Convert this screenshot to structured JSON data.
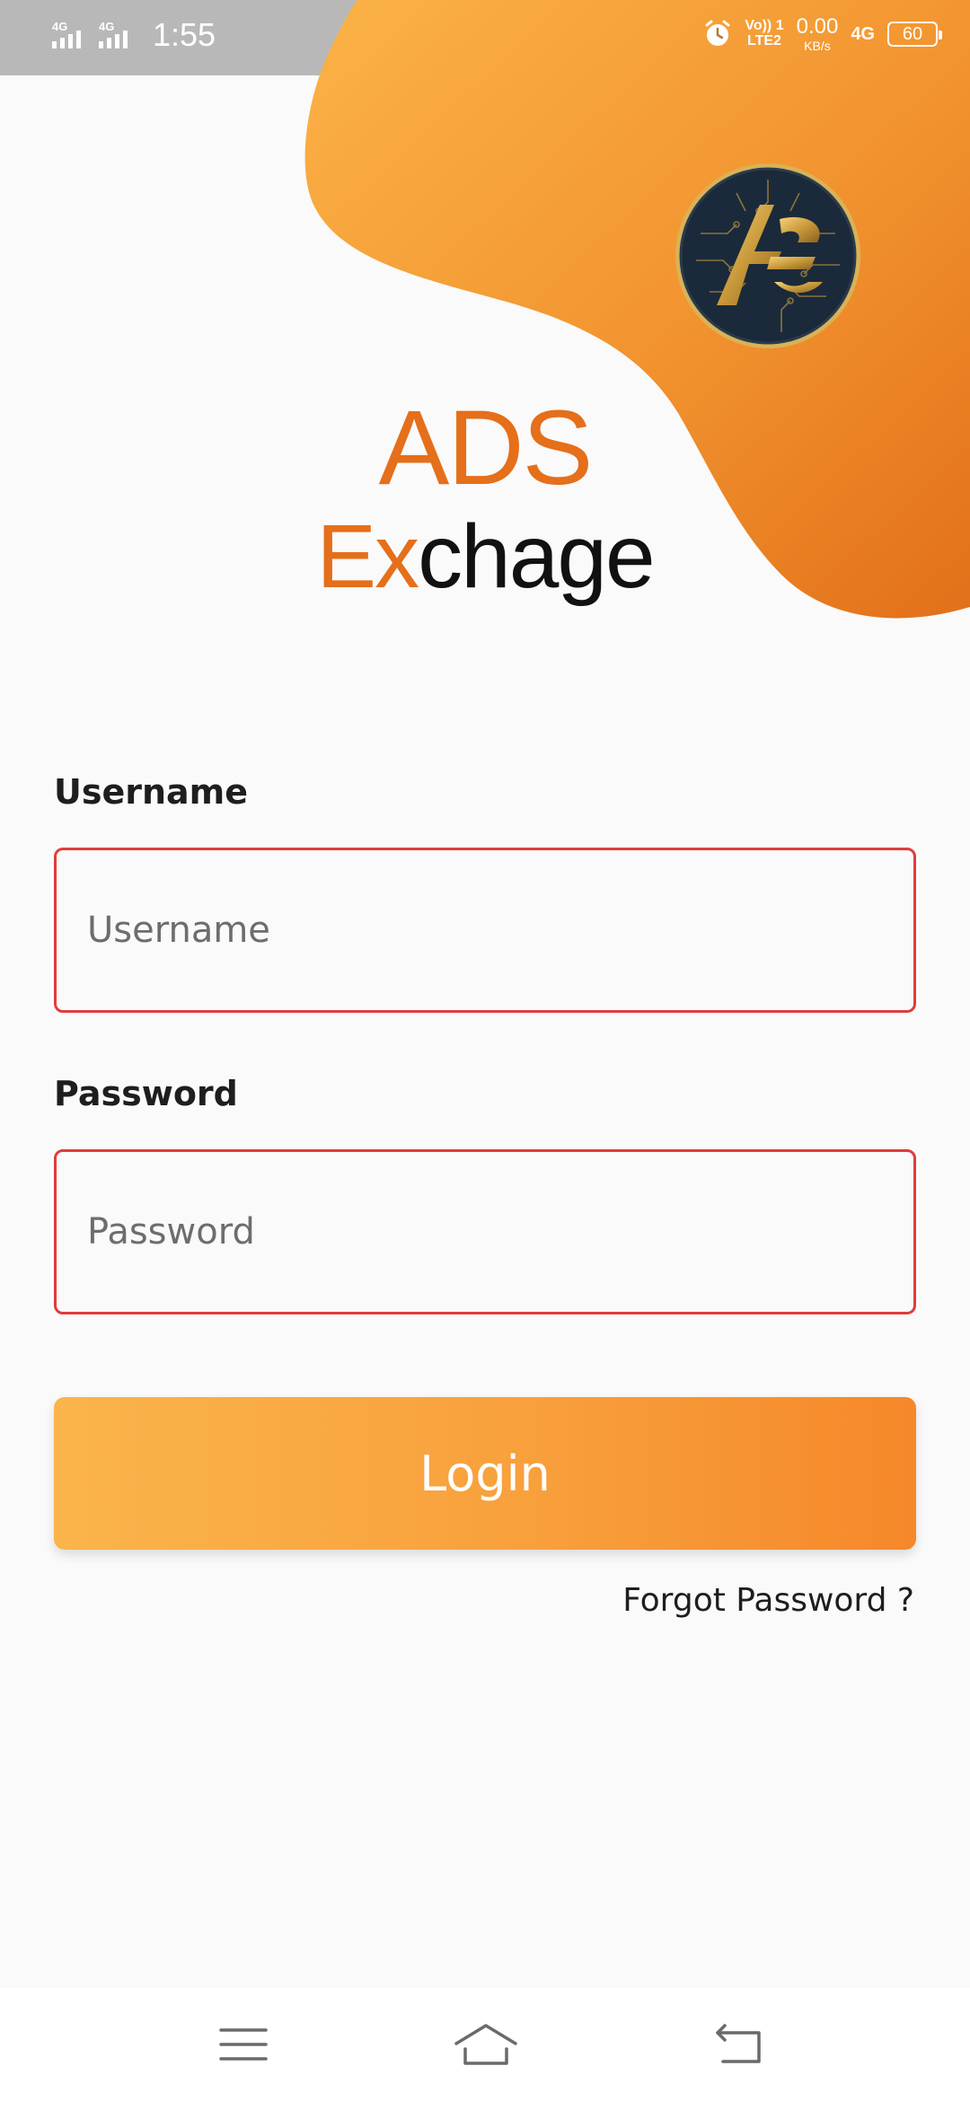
{
  "status_bar": {
    "time": "1:55",
    "network_1": "4G",
    "network_2": "4G",
    "volte": "Vo)) 1",
    "lte": "LTE2",
    "speed_value": "0.00",
    "speed_unit": "KB/s",
    "network_3": "4G",
    "battery": "60",
    "icons": [
      "signal-icon",
      "signal-icon",
      "alarm-icon",
      "battery-icon"
    ]
  },
  "brand": {
    "logo_icon": "ae-coin-logo",
    "line1": "ADS",
    "line2_highlight": "Ex",
    "line2_rest": "chage"
  },
  "form": {
    "username_label": "Username",
    "username_placeholder": "Username",
    "username_value": "",
    "password_label": "Password",
    "password_placeholder": "Password",
    "password_value": "",
    "login_label": "Login",
    "forgot_label": "Forgot Password ?"
  },
  "nav_bar": {
    "icons": [
      "menu-icon",
      "home-icon",
      "back-icon"
    ]
  },
  "colors": {
    "accent": "#e56f1a",
    "button_start": "#fbb44c",
    "button_end": "#f5882a",
    "field_border": "#e03c3c"
  }
}
